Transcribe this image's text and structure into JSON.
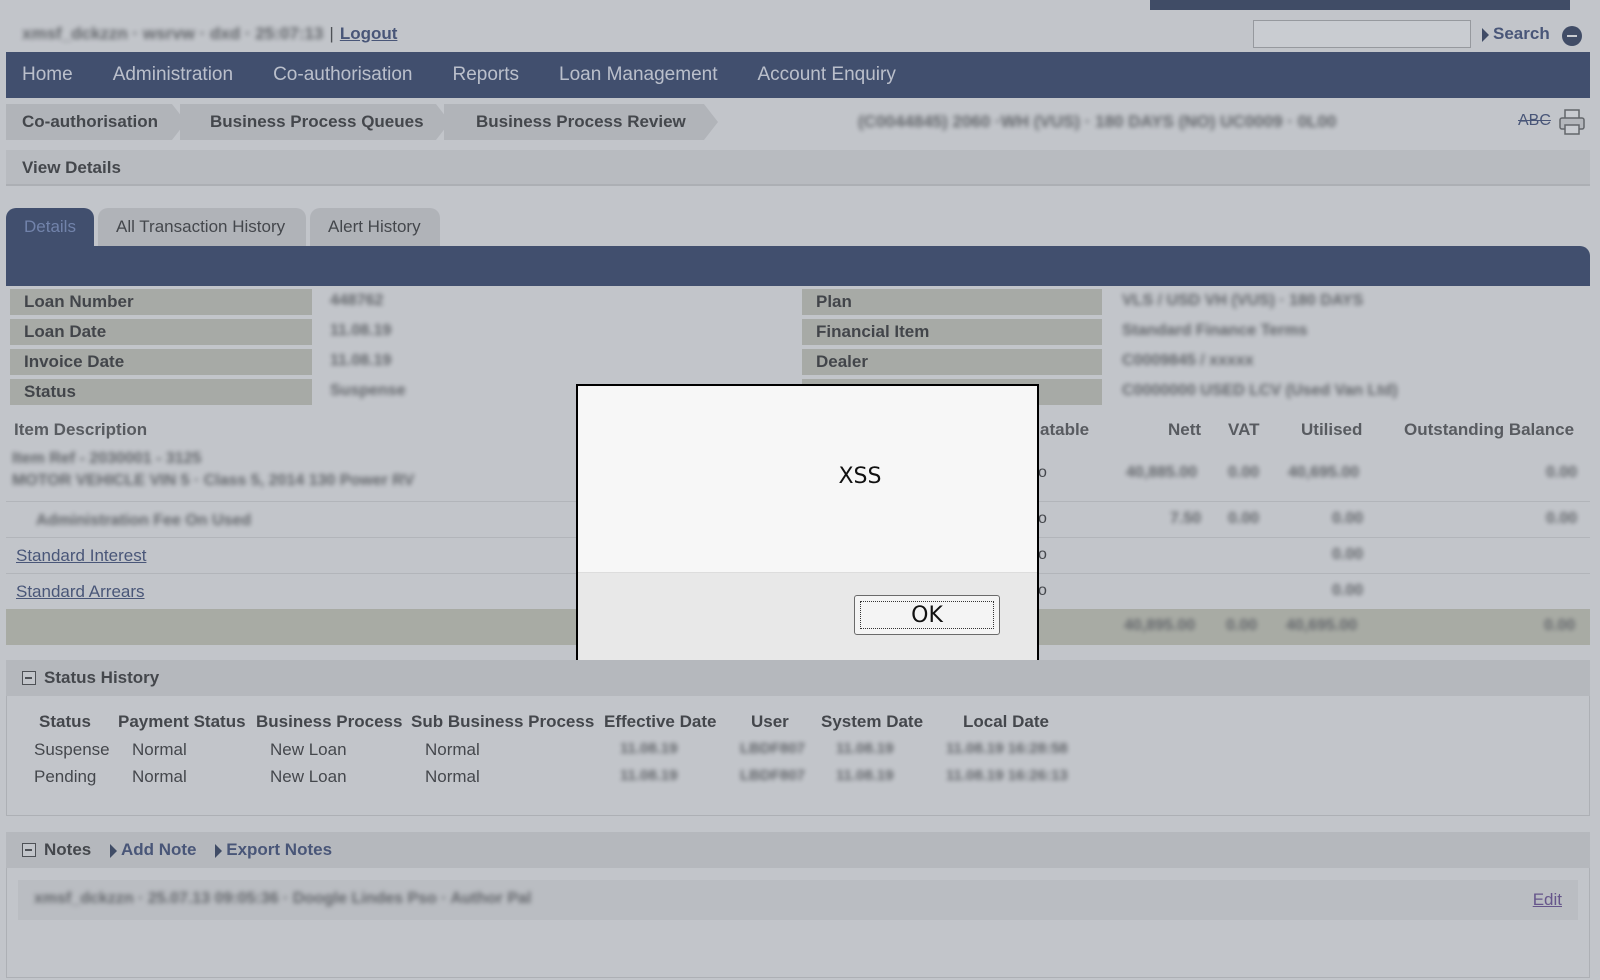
{
  "top": {
    "user_info_blurred": "xmsf_dckzzn · wsrvw · dxd · 25:07:13",
    "logout": "Logout",
    "search_label": "Search"
  },
  "nav": [
    "Home",
    "Administration",
    "Co-authorisation",
    "Reports",
    "Loan Management",
    "Account Enquiry"
  ],
  "breadcrumb": {
    "items": [
      "Co-authorisation",
      "Business Process Queues",
      "Business Process Review"
    ],
    "blurred_context": "(C0044845) 2060 ·WH (VUS) · 180 DAYS (NO) UC0009 · 0L00",
    "abc": "ABC"
  },
  "view_details": "View Details",
  "tabs": [
    "Details",
    "All Transaction History",
    "Alert History"
  ],
  "details": {
    "left": [
      {
        "label": "Loan Number",
        "value": "448762"
      },
      {
        "label": "Loan Date",
        "value": "11.08.19"
      },
      {
        "label": "Invoice Date",
        "value": "11.08.19"
      },
      {
        "label": "Status",
        "value": "Suspense"
      }
    ],
    "right": [
      {
        "label": "Plan",
        "value": "VLS / USD VH (VUS) · 180 DAYS"
      },
      {
        "label": "Financial Item",
        "value": "Standard Finance Terms"
      },
      {
        "label": "Dealer",
        "value": "C0009845 / xxxxx"
      },
      {
        "label": "",
        "value": "C0000000 USED LCV (Used Van Ltd)"
      }
    ]
  },
  "items": {
    "headers": [
      "Item Description",
      "atable",
      "Nett",
      "VAT",
      "Utilised",
      "Outstanding Balance"
    ],
    "rows": [
      {
        "desc": "Item Ref - 2030001 - 3125",
        "desc2": "MOTOR VEHICLE VIN 5 · Class 5, 2014 130 Power RV",
        "flag": "o",
        "nett": "40,885.00",
        "vat": "0.00",
        "utilised": "40,695.00",
        "balance": "0.00"
      },
      {
        "desc": "Administration Fee On Used",
        "flag": "o",
        "nett": "7.50",
        "vat": "0.00",
        "utilised": "0.00",
        "balance": "0.00"
      },
      {
        "link": "Standard Interest",
        "flag": "o",
        "utilised": "0.00"
      },
      {
        "link": "Standard Arrears",
        "flag": "o",
        "utilised": "0.00"
      }
    ],
    "totals": {
      "nett": "40,895.00",
      "vat": "0.00",
      "utilised": "40,695.00",
      "balance": "0.00"
    }
  },
  "status_history": {
    "title": "Status History",
    "headers": [
      "Status",
      "Payment Status",
      "Business Process",
      "Sub Business Process",
      "Effective Date",
      "User",
      "System Date",
      "Local Date"
    ],
    "rows": [
      {
        "status": "Suspense",
        "payment": "Normal",
        "bp": "New Loan",
        "sub": "Normal",
        "eff": "11.08.19",
        "user": "LBDF807",
        "sys": "11.08.19",
        "local": "11.08.19 16:28:58"
      },
      {
        "status": "Pending",
        "payment": "Normal",
        "bp": "New Loan",
        "sub": "Normal",
        "eff": "11.08.19",
        "user": "LBDF807",
        "sys": "11.08.19",
        "local": "11.08.19 16:26:13"
      }
    ]
  },
  "notes": {
    "title": "Notes",
    "add": "Add Note",
    "export": "Export Notes",
    "entry_blurred": "xmsf_dckzzn · 25.07.13 09:05:36 · Doogle Lindes Pso · Author Pal",
    "edit": "Edit"
  },
  "dialog": {
    "message": "XSS",
    "ok": "OK"
  }
}
